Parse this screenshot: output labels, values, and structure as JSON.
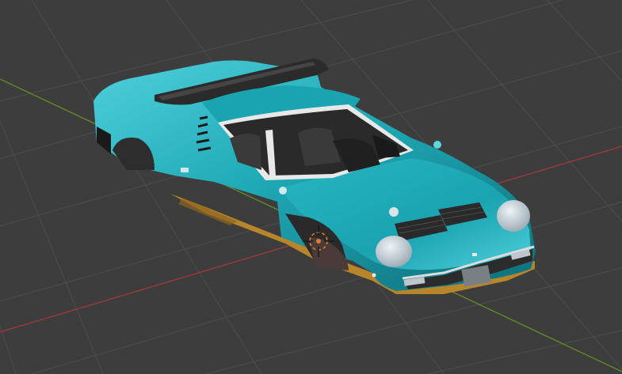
{
  "viewport": {
    "background": "#3d3d3d",
    "grid_color": "#4a4a4a",
    "x_axis_color": "#9a3a3a",
    "y_axis_color": "#5f8a2a"
  },
  "scene": {
    "object": "car-body",
    "body_color": "#1fa9b6",
    "body_shadow_color": "#0e6f7a",
    "underbody_color": "#b8862a",
    "glass_color": "#2a2a2a",
    "trim_color": "#e8e8e8",
    "wing_color": "#2b2b2b",
    "headlight_color": "#c9d3dc",
    "origin_marker_color": "#e07a2a"
  }
}
